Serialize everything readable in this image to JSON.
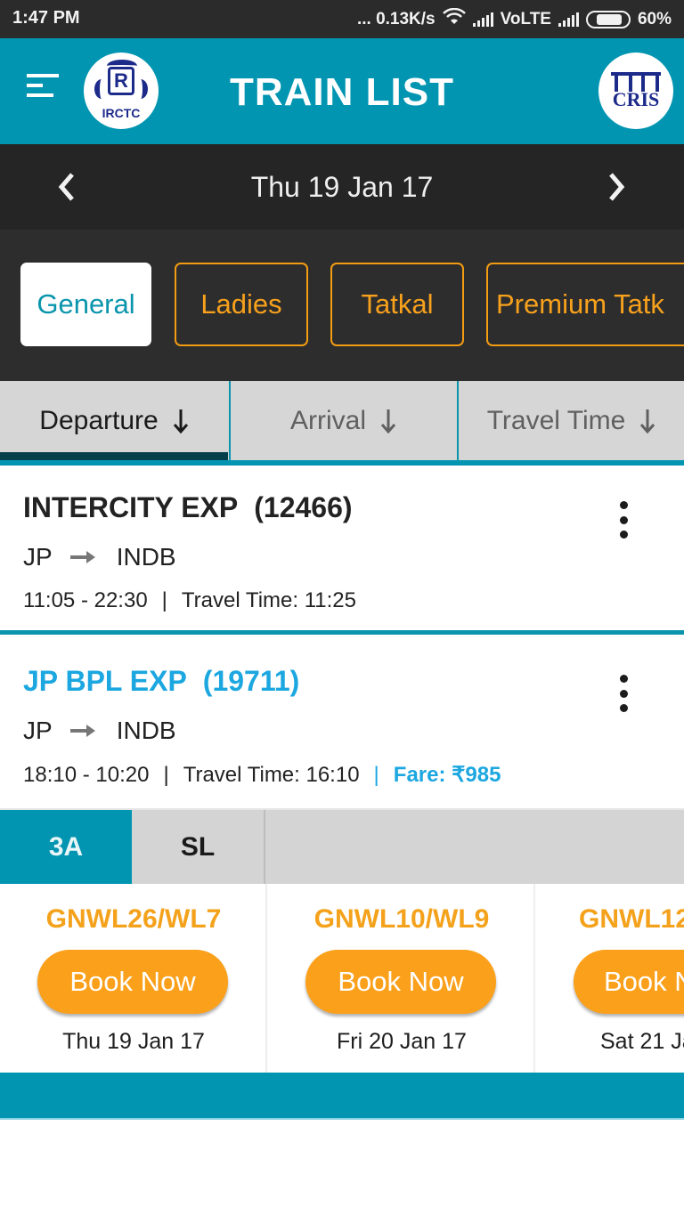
{
  "status_bar": {
    "time": "1:47 PM",
    "network_speed": "... 0.13K/s",
    "volte": "VoLTE",
    "battery": "60%",
    "battery_level_percent": 60,
    "icons": [
      "wifi-icon",
      "signal-icon",
      "signal-icon",
      "battery-icon"
    ]
  },
  "header": {
    "title": "TRAIN LIST",
    "left_logo_text": "IRCTC",
    "right_logo_text": "CRIS",
    "menu_icon": "hamburger-menu-icon"
  },
  "date_nav": {
    "date": "Thu 19 Jan 17",
    "prev_icon": "chevron-left-icon",
    "next_icon": "chevron-right-icon"
  },
  "quota_chips": [
    {
      "label": "General",
      "active": true
    },
    {
      "label": "Ladies",
      "active": false
    },
    {
      "label": "Tatkal",
      "active": false
    },
    {
      "label": "Premium Tatk",
      "active": false
    }
  ],
  "sort_tabs": [
    {
      "label": "Departure",
      "active": true,
      "icon": "arrow-down-icon"
    },
    {
      "label": "Arrival",
      "active": false,
      "icon": "arrow-down-icon"
    },
    {
      "label": "Travel Time",
      "active": false,
      "icon": "arrow-down-icon"
    }
  ],
  "trains": [
    {
      "name": "INTERCITY EXP",
      "number": "(12466)",
      "from": "JP",
      "to": "INDB",
      "timing": "11:05 - 22:30",
      "separator": "|",
      "travel_time": "Travel Time: 11:25"
    },
    {
      "name": "JP BPL EXP",
      "number": "(19711)",
      "from": "JP",
      "to": "INDB",
      "timing": "18:10 - 10:20",
      "separator": "|",
      "travel_time": "Travel Time: 16:10",
      "fare": "Fare: ₹985"
    }
  ],
  "class_tabs": [
    {
      "label": "3A",
      "active": true
    },
    {
      "label": "SL",
      "active": false
    }
  ],
  "availability": [
    {
      "status": "GNWL26/WL7",
      "button": "Book Now",
      "date": "Thu 19 Jan 17"
    },
    {
      "status": "GNWL10/WL9",
      "button": "Book Now",
      "date": "Fri 20 Jan 17"
    },
    {
      "status": "GNWL12",
      "button": "Book N",
      "date": "Sat 21 Ja"
    }
  ],
  "colors": {
    "primary": "#0295b1",
    "accent_orange": "#fba01a",
    "dark_bg": "#252525",
    "link_blue": "#1ca7e0"
  }
}
